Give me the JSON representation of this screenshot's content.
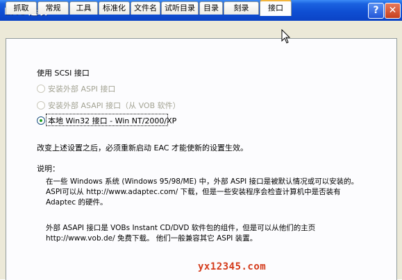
{
  "window": {
    "title": "EAC 选项",
    "help_glyph": "?",
    "close_glyph": "✕"
  },
  "tabs": [
    "抓取",
    "常规",
    "工具",
    "标准化",
    "文件名",
    "试听目录",
    "目录",
    "刻录",
    "接口"
  ],
  "active_tab": "接口",
  "interface": {
    "group_label": "使用 SCSI 接口",
    "options": [
      {
        "label": "安装外部 ASPI 接口",
        "enabled": false,
        "selected": false
      },
      {
        "label": "安装外部 ASAPI 接口（从 VOB 软件）",
        "enabled": false,
        "selected": false
      },
      {
        "label": "本地 Win32 接口 - Win NT/2000/XP",
        "enabled": true,
        "selected": true
      }
    ],
    "notice": "改变上述设置之后，必须重新启动 EAC 才能使新的设置生效。",
    "explain_label": "说明：",
    "para1": [
      "在一些 Windows 系统 (Windows 95/98/ME) 中，外部 ASPI 接口是被默认情况或可以安装的。",
      "ASPI可以从 http://www.adaptec.com/ 下载，但是一些安装程序会检查计算机中是否装有",
      "Adaptec 的硬件。"
    ],
    "para2": [
      "外部 ASAPI 接口是 VOBs Instant CD/DVD 软件包的组件，但是可以从他们的主页",
      "http://www.vob.de/ 免费下载。 他们一般兼容其它 ASPI 装置。"
    ]
  },
  "watermark": "yx12345.com"
}
